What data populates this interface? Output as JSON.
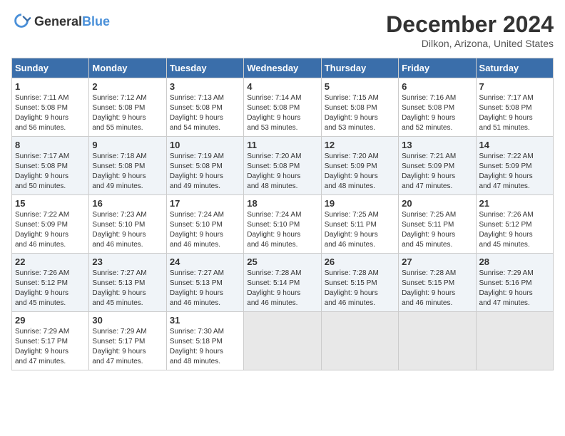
{
  "header": {
    "logo_general": "General",
    "logo_blue": "Blue",
    "month_title": "December 2024",
    "location": "Dilkon, Arizona, United States"
  },
  "weekdays": [
    "Sunday",
    "Monday",
    "Tuesday",
    "Wednesday",
    "Thursday",
    "Friday",
    "Saturday"
  ],
  "weeks": [
    [
      {
        "day": "1",
        "sunrise": "7:11 AM",
        "sunset": "5:08 PM",
        "daylight": "9 hours and 56 minutes."
      },
      {
        "day": "2",
        "sunrise": "7:12 AM",
        "sunset": "5:08 PM",
        "daylight": "9 hours and 55 minutes."
      },
      {
        "day": "3",
        "sunrise": "7:13 AM",
        "sunset": "5:08 PM",
        "daylight": "9 hours and 54 minutes."
      },
      {
        "day": "4",
        "sunrise": "7:14 AM",
        "sunset": "5:08 PM",
        "daylight": "9 hours and 53 minutes."
      },
      {
        "day": "5",
        "sunrise": "7:15 AM",
        "sunset": "5:08 PM",
        "daylight": "9 hours and 53 minutes."
      },
      {
        "day": "6",
        "sunrise": "7:16 AM",
        "sunset": "5:08 PM",
        "daylight": "9 hours and 52 minutes."
      },
      {
        "day": "7",
        "sunrise": "7:17 AM",
        "sunset": "5:08 PM",
        "daylight": "9 hours and 51 minutes."
      }
    ],
    [
      {
        "day": "8",
        "sunrise": "7:17 AM",
        "sunset": "5:08 PM",
        "daylight": "9 hours and 50 minutes."
      },
      {
        "day": "9",
        "sunrise": "7:18 AM",
        "sunset": "5:08 PM",
        "daylight": "9 hours and 49 minutes."
      },
      {
        "day": "10",
        "sunrise": "7:19 AM",
        "sunset": "5:08 PM",
        "daylight": "9 hours and 49 minutes."
      },
      {
        "day": "11",
        "sunrise": "7:20 AM",
        "sunset": "5:08 PM",
        "daylight": "9 hours and 48 minutes."
      },
      {
        "day": "12",
        "sunrise": "7:20 AM",
        "sunset": "5:09 PM",
        "daylight": "9 hours and 48 minutes."
      },
      {
        "day": "13",
        "sunrise": "7:21 AM",
        "sunset": "5:09 PM",
        "daylight": "9 hours and 47 minutes."
      },
      {
        "day": "14",
        "sunrise": "7:22 AM",
        "sunset": "5:09 PM",
        "daylight": "9 hours and 47 minutes."
      }
    ],
    [
      {
        "day": "15",
        "sunrise": "7:22 AM",
        "sunset": "5:09 PM",
        "daylight": "9 hours and 46 minutes."
      },
      {
        "day": "16",
        "sunrise": "7:23 AM",
        "sunset": "5:10 PM",
        "daylight": "9 hours and 46 minutes."
      },
      {
        "day": "17",
        "sunrise": "7:24 AM",
        "sunset": "5:10 PM",
        "daylight": "9 hours and 46 minutes."
      },
      {
        "day": "18",
        "sunrise": "7:24 AM",
        "sunset": "5:10 PM",
        "daylight": "9 hours and 46 minutes."
      },
      {
        "day": "19",
        "sunrise": "7:25 AM",
        "sunset": "5:11 PM",
        "daylight": "9 hours and 46 minutes."
      },
      {
        "day": "20",
        "sunrise": "7:25 AM",
        "sunset": "5:11 PM",
        "daylight": "9 hours and 45 minutes."
      },
      {
        "day": "21",
        "sunrise": "7:26 AM",
        "sunset": "5:12 PM",
        "daylight": "9 hours and 45 minutes."
      }
    ],
    [
      {
        "day": "22",
        "sunrise": "7:26 AM",
        "sunset": "5:12 PM",
        "daylight": "9 hours and 45 minutes."
      },
      {
        "day": "23",
        "sunrise": "7:27 AM",
        "sunset": "5:13 PM",
        "daylight": "9 hours and 45 minutes."
      },
      {
        "day": "24",
        "sunrise": "7:27 AM",
        "sunset": "5:13 PM",
        "daylight": "9 hours and 46 minutes."
      },
      {
        "day": "25",
        "sunrise": "7:28 AM",
        "sunset": "5:14 PM",
        "daylight": "9 hours and 46 minutes."
      },
      {
        "day": "26",
        "sunrise": "7:28 AM",
        "sunset": "5:15 PM",
        "daylight": "9 hours and 46 minutes."
      },
      {
        "day": "27",
        "sunrise": "7:28 AM",
        "sunset": "5:15 PM",
        "daylight": "9 hours and 46 minutes."
      },
      {
        "day": "28",
        "sunrise": "7:29 AM",
        "sunset": "5:16 PM",
        "daylight": "9 hours and 47 minutes."
      }
    ],
    [
      {
        "day": "29",
        "sunrise": "7:29 AM",
        "sunset": "5:17 PM",
        "daylight": "9 hours and 47 minutes."
      },
      {
        "day": "30",
        "sunrise": "7:29 AM",
        "sunset": "5:17 PM",
        "daylight": "9 hours and 47 minutes."
      },
      {
        "day": "31",
        "sunrise": "7:30 AM",
        "sunset": "5:18 PM",
        "daylight": "9 hours and 48 minutes."
      },
      null,
      null,
      null,
      null
    ]
  ],
  "labels": {
    "sunrise": "Sunrise:",
    "sunset": "Sunset:",
    "daylight": "Daylight:"
  }
}
